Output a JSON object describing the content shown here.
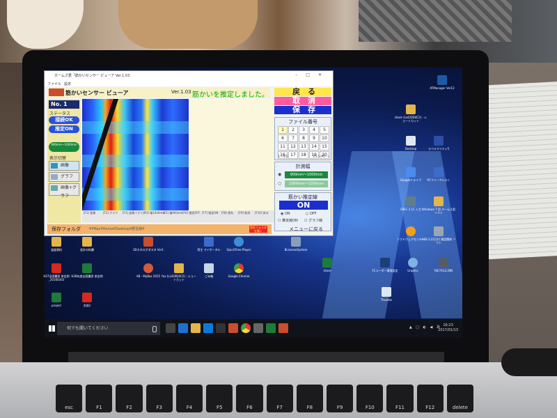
{
  "app": {
    "title_bar": "ホームズ君「筋かいセンサー ビューア Ver.1.03",
    "menu": [
      "ファイル",
      "設定"
    ],
    "logo_text": "ホームズ君",
    "name": "筋かいセンサー ビューア",
    "version": "Ver.1.03",
    "message": "筋かいを推定しました。",
    "no_label": "No. 1",
    "status_label": "ステータス",
    "connect_btn": "接続OK",
    "estimate_btn": "推定ON",
    "range_btn": "900mm～1000mm",
    "display_label": "表示切替",
    "view_image": "画像",
    "view_graph": "グラフ",
    "view_both": "画像+グラフ",
    "ruler": [
      "[F1] 画像",
      "[F2] グラフ",
      "[F3] 画像＋グラフ",
      "[F4] 幅1000mm",
      "[F5] 幅900mm",
      "[F6] 推定OFF",
      "[F7] 推定ON",
      "[F8] 保存",
      "[F9] 取消",
      "[F10] 戻る"
    ],
    "folder_label": "保存フォルダ",
    "folder_path": "¥¥Mac¥Home¥Desktop¥野呂様¥",
    "folder_red": "保存フォルダを開く",
    "back_btn": "戻　る",
    "cancel_btn": "取　消",
    "save_btn": "保　存",
    "file_title": "ファイル番号",
    "file_numbers": [
      "1",
      "2",
      "3",
      "4",
      "5",
      "6",
      "7",
      "8",
      "9",
      "10",
      "11",
      "12",
      "13",
      "14",
      "15",
      "16",
      "17",
      "18",
      "19",
      "20"
    ],
    "page_prev": "1～20",
    "page_next": "21～40 →",
    "width_title": "計測幅",
    "width_opt1": "900mm～1000mm",
    "width_opt2": "1000mm～1200mm",
    "line_title": "筋かい推定線",
    "line_on": "ON",
    "radio_on": "ON",
    "radio_off": "OFF",
    "check1": "推定線ON",
    "check2": "グラフ線",
    "menu_back": "メニューに戻る"
  },
  "desktop": {
    "icons": [
      {
        "label": "ATManager Ver12"
      },
      {
        "label": "share (Ls420D4C2) - ショートカット"
      },
      {
        "label": "Desktop"
      },
      {
        "label": "ラベルマイティ5"
      },
      {
        "label": "Googleドライブ"
      },
      {
        "label": "PCフリーアシスト"
      },
      {
        "label": "Windows 7 用 ホームズ君ソフト"
      },
      {
        "label": "SPEC 2 LC 入力"
      },
      {
        "label": "ソフトウェアセンター"
      },
      {
        "label": "H28.3.22日付 建設関係 ソフト"
      },
      {
        "label": "Thumbs"
      },
      {
        "label": "RECYCLE.BIN"
      },
      {
        "label": "share"
      },
      {
        "label": "FCコーダー環境設定"
      },
      {
        "label": "Uraphic"
      },
      {
        "label": "温度資料"
      },
      {
        "label": "会計の料書"
      },
      {
        "label": "3Dカタログダスタ Ver1"
      },
      {
        "label": "荷主 マイポータル"
      },
      {
        "label": "QuickTime Player"
      },
      {
        "label": "BLicenseSystem"
      },
      {
        "label": "H27全国書家 茶会例_20160303"
      },
      {
        "label": "H28年度全国書家 茶会例"
      },
      {
        "label": "AB - MyBox 2015"
      },
      {
        "label": "fax (Ls420D4C2) - ショートカット"
      },
      {
        "label": "ごみ箱"
      },
      {
        "label": "Google Chrome"
      },
      {
        "label": "project"
      },
      {
        "label": "名前1"
      }
    ]
  },
  "taskbar": {
    "search_placeholder": "何でも聞いてください",
    "time": "16:23",
    "date": "2017/01/13"
  },
  "keyboard": {
    "keys": [
      "esc",
      "F1",
      "F2",
      "F3",
      "F4",
      "F5",
      "F6",
      "F7",
      "F8",
      "F9",
      "F10",
      "F11",
      "F12",
      "delete"
    ]
  }
}
